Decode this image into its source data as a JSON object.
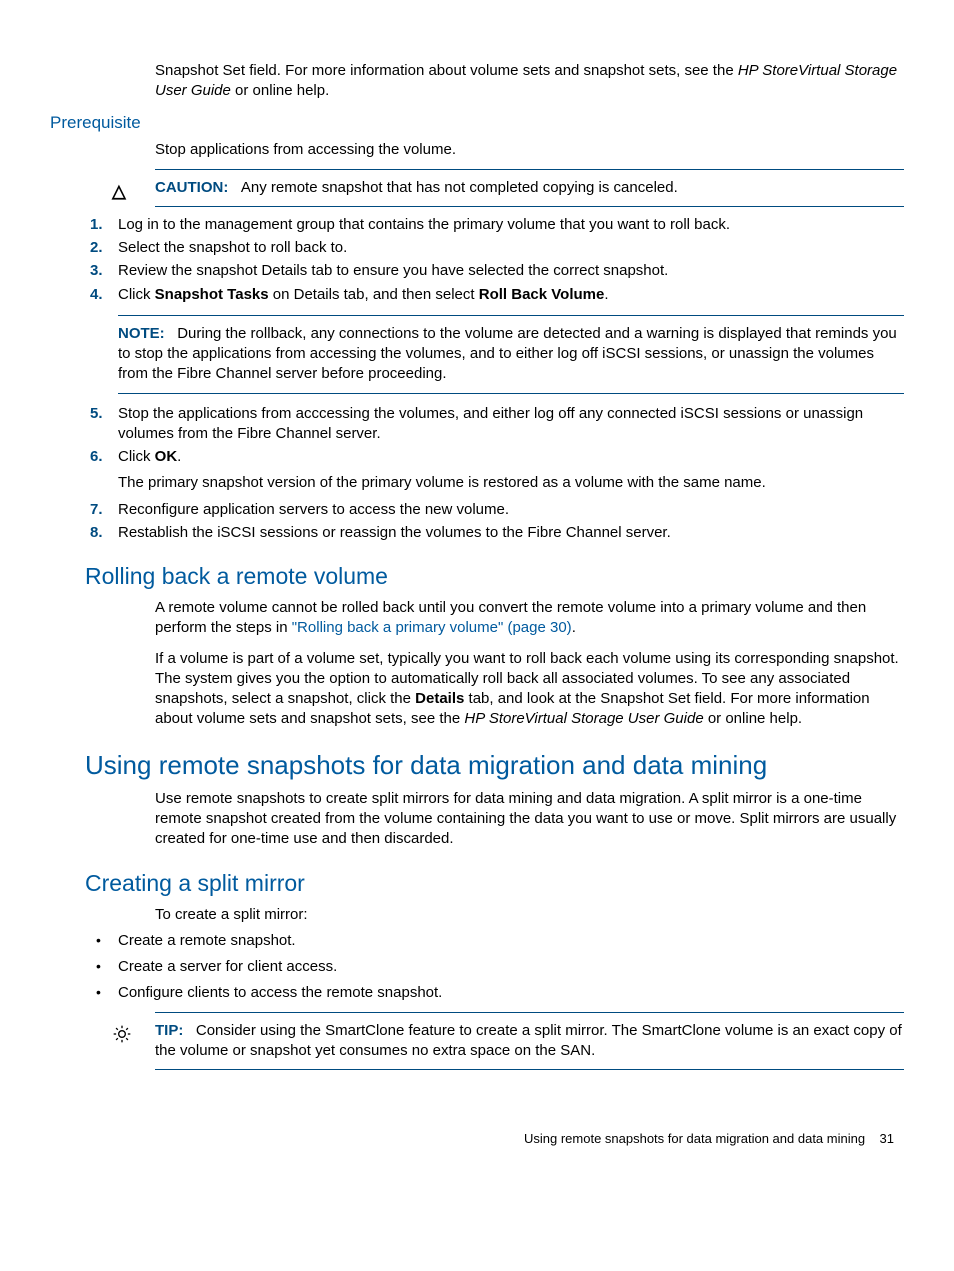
{
  "intro": {
    "p1a": "Snapshot Set field. For more information about volume sets and snapshot sets, see the ",
    "p1b": "HP StoreVirtual Storage User Guide",
    "p1c": " or online help."
  },
  "prereq": {
    "heading": "Prerequisite",
    "text": "Stop applications from accessing the volume."
  },
  "caution": {
    "label": "CAUTION:",
    "text": "Any remote snapshot that has not completed copying is canceled."
  },
  "steps": {
    "s1": "Log in to the management group that contains the primary volume that you want to roll back.",
    "s2": "Select the snapshot to roll back to.",
    "s3": "Review the snapshot Details tab to ensure you have selected the correct snapshot.",
    "s4a": "Click ",
    "s4b": "Snapshot Tasks",
    "s4c": " on Details tab, and then select ",
    "s4d": "Roll Back Volume",
    "s4e": ".",
    "note_label": "NOTE:",
    "note_text": "During the rollback, any connections to the volume are detected and a warning is displayed that reminds you to stop the applications from accessing the volumes, and to either log off iSCSI sessions, or unassign the volumes from the Fibre Channel server before proceeding.",
    "s5": "Stop the applications from acccessing the volumes, and either log off any connected iSCSI sessions or unassign volumes from the Fibre Channel server.",
    "s6a": "Click ",
    "s6b": "OK",
    "s6c": ".",
    "s6_sub": "The primary snapshot version of the primary volume is restored as a volume with the same name.",
    "s7": "Reconfigure application servers to access the new volume.",
    "s8": "Restablish the iSCSI sessions or reassign the volumes to the Fibre Channel server."
  },
  "rolling": {
    "heading": "Rolling back a remote volume",
    "p1a": "A remote volume cannot be rolled back until you convert the remote volume into a primary volume and then perform the steps in ",
    "p1b": "\"Rolling back a primary volume\" (page 30)",
    "p1c": ".",
    "p2a": "If a volume is part of a volume set, typically you want to roll back each volume using its corresponding snapshot. The system gives you the option to automatically roll back all associated volumes. To see any associated snapshots, select a snapshot, click the ",
    "p2b": "Details",
    "p2c": " tab, and look at the Snapshot Set field. For more information about volume sets and snapshot sets, see the ",
    "p2d": "HP StoreVirtual Storage User Guide",
    "p2e": " or online help."
  },
  "migration": {
    "heading": "Using remote snapshots for data migration and data mining",
    "p1": "Use remote snapshots to create split mirrors for data mining and data migration. A split mirror is a one-time remote snapshot created from the volume containing the data you want to use or move. Split mirrors are usually created for one-time use and then discarded."
  },
  "split": {
    "heading": "Creating a split mirror",
    "intro": "To create a split mirror:",
    "b1": "Create a remote snapshot.",
    "b2": "Create a server for client access.",
    "b3": "Configure clients to access the remote snapshot."
  },
  "tip": {
    "label": "TIP:",
    "text": "Consider using the SmartClone feature to create a split mirror. The SmartClone volume is an exact copy of the volume or snapshot yet consumes no extra space on the SAN."
  },
  "footer": {
    "text": "Using remote snapshots for data migration and data mining",
    "page": "31"
  }
}
